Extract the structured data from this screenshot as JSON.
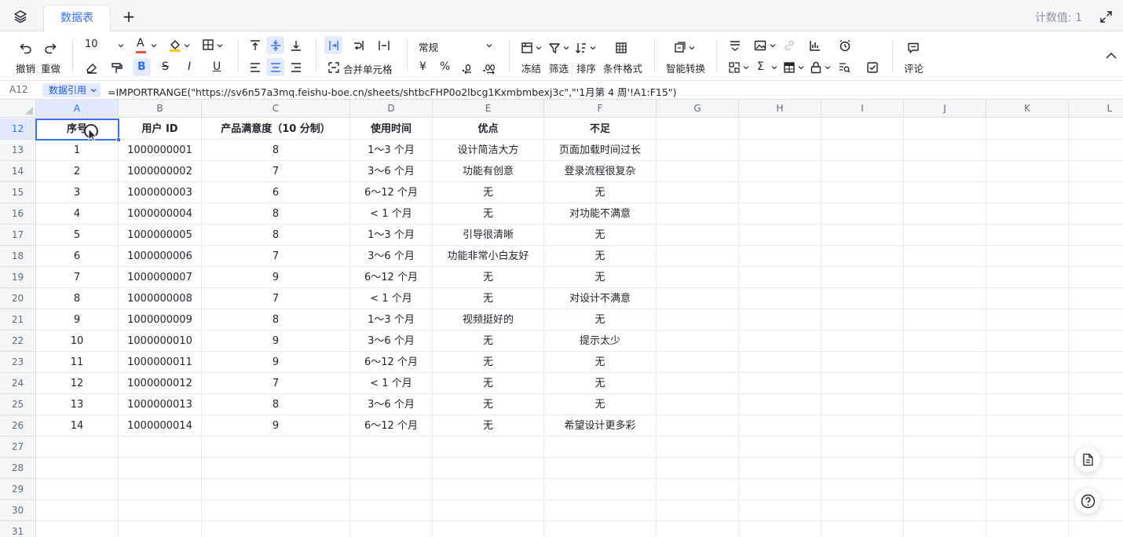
{
  "tabs": {
    "active_label": "数据表",
    "count_label": "计数值: 1"
  },
  "toolbar": {
    "undo": "撤销",
    "redo": "重做",
    "font_size": "10",
    "merge_cells": "合并单元格",
    "number_format": "常规",
    "currency_symbol": "¥",
    "percent_symbol": "%",
    "freeze": "冻结",
    "filter": "筛选",
    "sort": "排序",
    "conditional_format": "条件格式",
    "smart_convert": "智能转换",
    "comment": "评论",
    "accent_color": "#3370ff",
    "font_color": "#f54a45",
    "fill_color": "#ffc60a"
  },
  "formula_bar": {
    "cell_ref": "A12",
    "badge": "数据引用",
    "formula": "=IMPORTRANGE(\"https://sv6n57a3mq.feishu-boe.cn/sheets/shtbcFHP0o2lbcg1Kxmbmbexj3c\",\"'1月第 4 周'!A1:F15\")"
  },
  "columns": [
    "A",
    "B",
    "C",
    "D",
    "E",
    "F",
    "G",
    "H",
    "I",
    "J",
    "K",
    "L"
  ],
  "rows": [
    "12",
    "13",
    "14",
    "15",
    "16",
    "17",
    "18",
    "19",
    "20",
    "21",
    "22",
    "23",
    "24",
    "25",
    "26",
    "27",
    "28",
    "29",
    "30",
    "31"
  ],
  "header_row": [
    "序号",
    "用户 ID",
    "产品满意度（10 分制）",
    "使用时间",
    "优点",
    "不足"
  ],
  "data_rows": [
    [
      "1",
      "1000000001",
      "8",
      "1～3 个月",
      "设计简洁大方",
      "页面加载时间过长"
    ],
    [
      "2",
      "1000000002",
      "7",
      "3～6 个月",
      "功能有创意",
      "登录流程很复杂"
    ],
    [
      "3",
      "1000000003",
      "6",
      "6～12 个月",
      "无",
      "无"
    ],
    [
      "4",
      "1000000004",
      "8",
      "< 1 个月",
      "无",
      "对功能不满意"
    ],
    [
      "5",
      "1000000005",
      "8",
      "1～3 个月",
      "引导很清晰",
      "无"
    ],
    [
      "6",
      "1000000006",
      "7",
      "3～6 个月",
      "功能非常小白友好",
      "无"
    ],
    [
      "7",
      "1000000007",
      "9",
      "6～12 个月",
      "无",
      "无"
    ],
    [
      "8",
      "1000000008",
      "7",
      "< 1 个月",
      "无",
      "对设计不满意"
    ],
    [
      "9",
      "1000000009",
      "8",
      "1～3 个月",
      "视频挺好的",
      "无"
    ],
    [
      "10",
      "1000000010",
      "9",
      "3～6 个月",
      "无",
      "提示太少"
    ],
    [
      "11",
      "1000000011",
      "9",
      "6～12 个月",
      "无",
      "无"
    ],
    [
      "12",
      "1000000012",
      "7",
      "< 1 个月",
      "无",
      "无"
    ],
    [
      "13",
      "1000000013",
      "8",
      "3～6 个月",
      "无",
      "无"
    ],
    [
      "14",
      "1000000014",
      "9",
      "6～12 个月",
      "无",
      "希望设计更多彩"
    ]
  ]
}
